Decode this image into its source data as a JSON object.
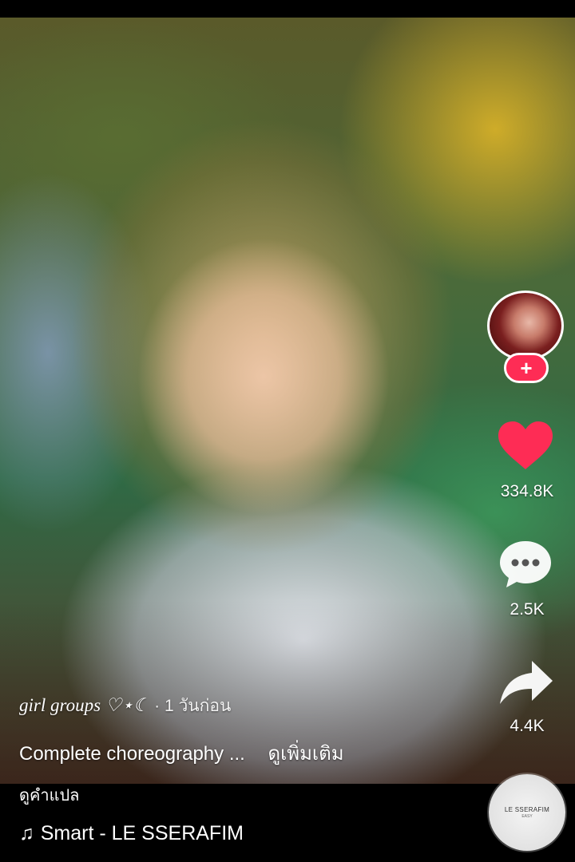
{
  "video": {
    "username": "girl groups ♡⋆☾",
    "posted_time": "· 1 วันก่อน",
    "description": "Complete choreography ...",
    "see_more_label": "ดูเพิ่มเติม",
    "translate_label": "ดูคำแปล",
    "sound_label": "Smart - LE SSERAFIM"
  },
  "actions": {
    "likes": "334.8K",
    "comments": "2.5K",
    "shares": "4.4K",
    "follow_symbol": "+"
  },
  "sound_disc": {
    "title": "LE SSERAFIM",
    "subtitle": "EASY"
  },
  "colors": {
    "like": "#fe2c55",
    "follow": "#fe2c55",
    "text": "#ffffff"
  },
  "icons": {
    "like": "heart-icon",
    "comment": "comment-bubble-icon",
    "share": "share-arrow-icon",
    "music": "music-note-icon"
  }
}
